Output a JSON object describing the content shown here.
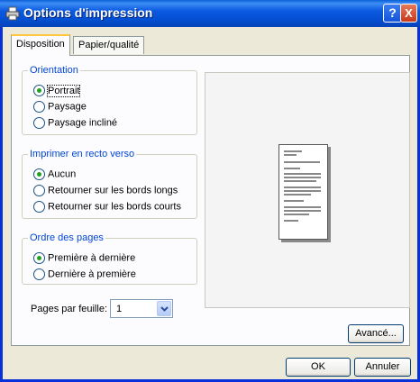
{
  "window": {
    "title": "Options d'impression",
    "help_glyph": "?",
    "close_glyph": "X"
  },
  "tabs": [
    {
      "label": "Disposition"
    },
    {
      "label": "Papier/qualité"
    }
  ],
  "orientation": {
    "legend": "Orientation",
    "options": [
      {
        "label": "Portrait",
        "checked": true
      },
      {
        "label": "Paysage",
        "checked": false
      },
      {
        "label": "Paysage incliné",
        "checked": false
      }
    ]
  },
  "duplex": {
    "legend": "Imprimer en recto verso",
    "options": [
      {
        "label": "Aucun",
        "checked": true
      },
      {
        "label": "Retourner sur les bords longs",
        "checked": false
      },
      {
        "label": "Retourner sur les bords courts",
        "checked": false
      }
    ]
  },
  "page_order": {
    "legend": "Ordre des pages",
    "options": [
      {
        "label": "Première à dernière",
        "checked": true
      },
      {
        "label": "Dernière à première",
        "checked": false
      }
    ]
  },
  "pages_per_sheet": {
    "label": "Pages par feuille:",
    "value": "1"
  },
  "buttons": {
    "advanced": "Avancé...",
    "ok": "OK",
    "cancel": "Annuler"
  }
}
